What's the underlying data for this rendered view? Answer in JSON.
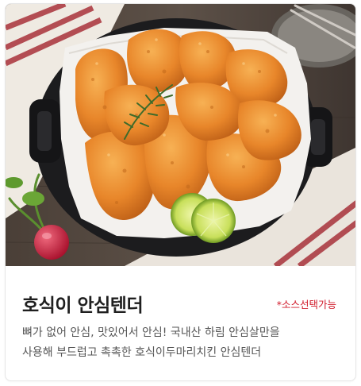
{
  "product": {
    "name": "호식이 안심텐더",
    "badge": "*소스선택가능",
    "description_lines": [
      "뼈가 없어 안심, 맛있어서 안심! 국내산 하림 안심살만을",
      "사용해 부드럽고 촉촉한 호식이두마리치킨 안심텐더"
    ]
  },
  "colors": {
    "title": "#1f1f1f",
    "badge": "#d11a2a",
    "description": "#555555",
    "card_border": "#e6e6e6"
  },
  "image": {
    "icon": "fried-chicken-tender-photo"
  }
}
